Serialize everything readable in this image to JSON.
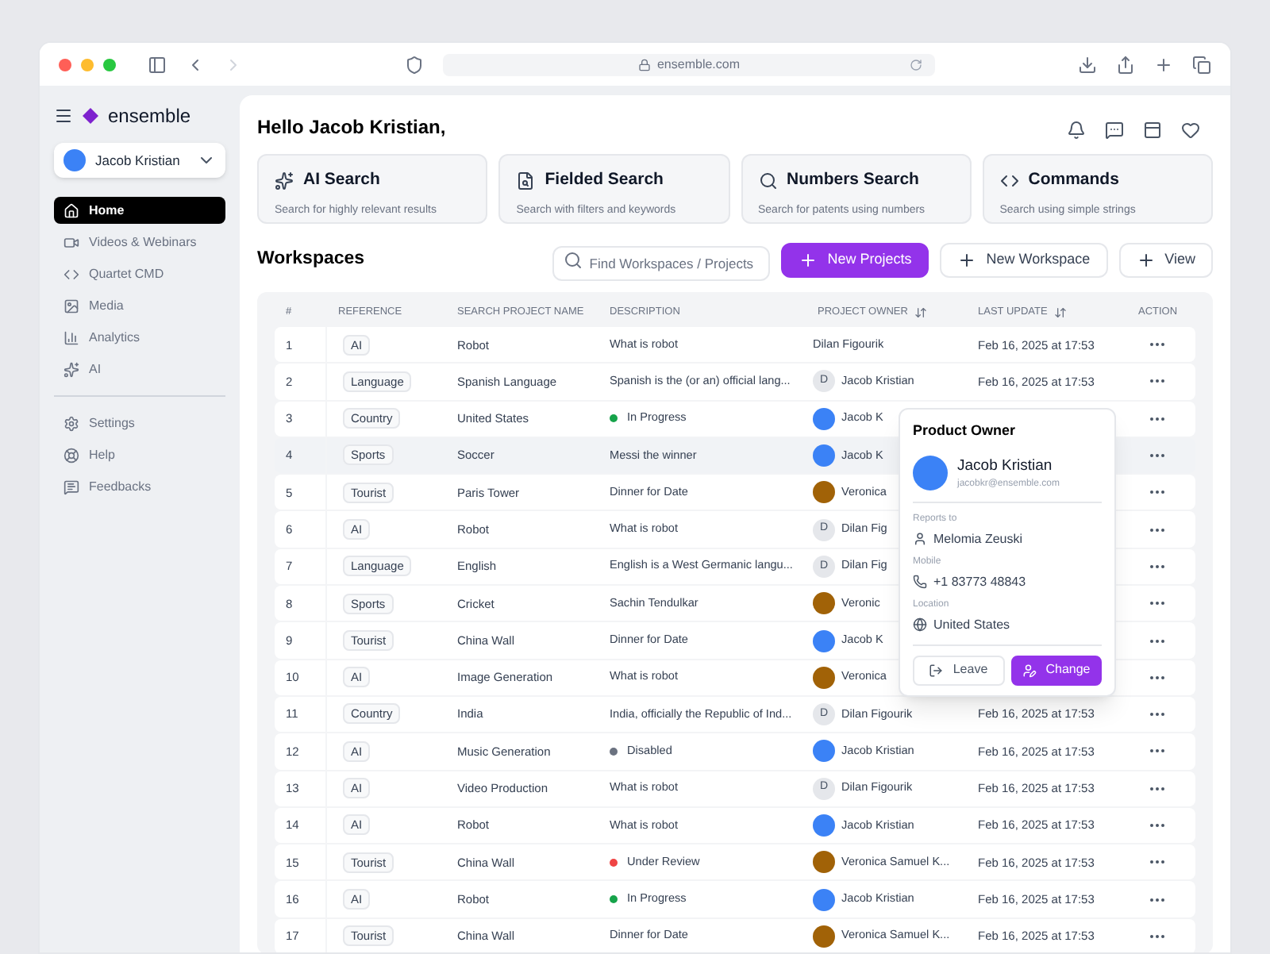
{
  "browser": {
    "url": "ensemble.com"
  },
  "sidebar": {
    "brand": "ensemble",
    "user": "Jacob Kristian",
    "items": [
      {
        "label": "Home",
        "selected": true
      },
      {
        "label": "Videos & Webinars",
        "selected": false
      },
      {
        "label": "Quartet CMD",
        "selected": false
      },
      {
        "label": "Media",
        "selected": false
      },
      {
        "label": "Analytics",
        "selected": false
      },
      {
        "label": "AI",
        "selected": false
      }
    ],
    "footer_items": [
      {
        "label": "Settings"
      },
      {
        "label": "Help"
      },
      {
        "label": "Feedbacks"
      }
    ]
  },
  "greeting": "Hello Jacob Kristian,",
  "search_cards": [
    {
      "title": "AI Search",
      "subtitle": "Search for highly relevant results"
    },
    {
      "title": "Fielded Search",
      "subtitle": "Search with filters and keywords"
    },
    {
      "title": "Numbers Search",
      "subtitle": "Search for patents using numbers"
    },
    {
      "title": "Commands",
      "subtitle": "Search using simple strings"
    }
  ],
  "workspaces": {
    "title": "Workspaces",
    "search": {
      "placeholder": "Find Workspaces / Projects"
    },
    "buttons": [
      {
        "label": "New Projects",
        "kind": "primary"
      },
      {
        "label": "New Workspace",
        "kind": "outline"
      },
      {
        "label": "View",
        "kind": "outline"
      }
    ]
  },
  "table": {
    "columns": [
      {
        "label": "#",
        "sortable": false
      },
      {
        "label": "REFERENCE",
        "sortable": false
      },
      {
        "label": "SEARCH PROJECT NAME",
        "sortable": false
      },
      {
        "label": "DESCRIPTION",
        "sortable": false
      },
      {
        "label": "PROJECT OWNER",
        "sortable": true
      },
      {
        "label": "LAST UPDATE",
        "sortable": true
      },
      {
        "label": "ACTION",
        "sortable": false
      }
    ],
    "rows": [
      {
        "num": "1",
        "reference": "AI",
        "name": "Robot",
        "description": {
          "kind": "text",
          "text": "What is robot"
        },
        "owner": {
          "kind": "none",
          "name": "Dilan Figourik"
        },
        "updated": "Feb 16, 2025 at 17:53",
        "selected": false
      },
      {
        "num": "2",
        "reference": "Language",
        "name": "Spanish Language",
        "description": {
          "kind": "text",
          "text": "Spanish is the (or an) official lang..."
        },
        "owner": {
          "kind": "initial",
          "initial": "D",
          "name": "Jacob Kristian"
        },
        "updated": "Feb 16, 2025 at 17:53",
        "selected": false
      },
      {
        "num": "3",
        "reference": "Country",
        "name": "United States",
        "description": {
          "kind": "status",
          "text": "In Progress",
          "color": "#16a34a"
        },
        "owner": {
          "kind": "photo",
          "color": "#3b82f6",
          "name": "Jacob K"
        },
        "selected": false
      },
      {
        "num": "4",
        "reference": "Sports",
        "name": "Soccer",
        "description": {
          "kind": "text",
          "text": "Messi the winner"
        },
        "owner": {
          "kind": "photo",
          "color": "#3b82f6",
          "name": "Jacob K"
        },
        "selected": true
      },
      {
        "num": "5",
        "reference": "Tourist",
        "name": "Paris Tower",
        "description": {
          "kind": "text",
          "text": "Dinner for Date"
        },
        "owner": {
          "kind": "photo",
          "color": "#a16207",
          "name": "Veronica"
        },
        "selected": false
      },
      {
        "num": "6",
        "reference": "AI",
        "name": "Robot",
        "description": {
          "kind": "text",
          "text": "What is robot"
        },
        "owner": {
          "kind": "initial",
          "initial": "D",
          "name": "Dilan Fig"
        },
        "selected": false
      },
      {
        "num": "7",
        "reference": "Language",
        "name": "English",
        "description": {
          "kind": "text",
          "text": "English is a West Germanic langu..."
        },
        "owner": {
          "kind": "initial",
          "initial": "D",
          "name": "Dilan Fig"
        },
        "selected": false
      },
      {
        "num": "8",
        "reference": "Sports",
        "name": "Cricket",
        "description": {
          "kind": "text",
          "text": "Sachin Tendulkar"
        },
        "owner": {
          "kind": "photo",
          "color": "#a16207",
          "name": "Veronic"
        },
        "selected": false
      },
      {
        "num": "9",
        "reference": "Tourist",
        "name": "China Wall",
        "description": {
          "kind": "text",
          "text": "Dinner for Date"
        },
        "owner": {
          "kind": "photo",
          "color": "#3b82f6",
          "name": "Jacob K"
        },
        "selected": false
      },
      {
        "num": "10",
        "reference": "AI",
        "name": "Image Generation",
        "description": {
          "kind": "text",
          "text": "What is robot"
        },
        "owner": {
          "kind": "photo",
          "color": "#a16207",
          "name": "Veronica"
        },
        "selected": false
      },
      {
        "num": "11",
        "reference": "Country",
        "name": "India",
        "description": {
          "kind": "text",
          "text": "India, officially the Republic of Ind..."
        },
        "owner": {
          "kind": "initial",
          "initial": "D",
          "name": "Dilan Figourik"
        },
        "updated": "Feb 16, 2025 at 17:53",
        "selected": false
      },
      {
        "num": "12",
        "reference": "AI",
        "name": "Music Generation",
        "description": {
          "kind": "status",
          "text": "Disabled",
          "color": "#6b7280"
        },
        "owner": {
          "kind": "photo",
          "color": "#3b82f6",
          "name": "Jacob Kristian"
        },
        "updated": "Feb 16, 2025 at 17:53",
        "selected": false
      },
      {
        "num": "13",
        "reference": "AI",
        "name": "Video Production",
        "description": {
          "kind": "text",
          "text": "What is robot"
        },
        "owner": {
          "kind": "initial",
          "initial": "D",
          "name": "Dilan Figourik"
        },
        "updated": "Feb 16, 2025 at 17:53",
        "selected": false
      },
      {
        "num": "14",
        "reference": "AI",
        "name": "Robot",
        "description": {
          "kind": "text",
          "text": "What is robot"
        },
        "owner": {
          "kind": "photo",
          "color": "#3b82f6",
          "name": "Jacob Kristian"
        },
        "updated": "Feb 16, 2025 at 17:53",
        "selected": false
      },
      {
        "num": "15",
        "reference": "Tourist",
        "name": "China Wall",
        "description": {
          "kind": "status",
          "text": "Under Review",
          "color": "#ef4444"
        },
        "owner": {
          "kind": "photo",
          "color": "#a16207",
          "name": "Veronica Samuel K..."
        },
        "updated": "Feb 16, 2025 at 17:53",
        "selected": false
      },
      {
        "num": "16",
        "reference": "AI",
        "name": "Robot",
        "description": {
          "kind": "status",
          "text": "In Progress",
          "color": "#16a34a"
        },
        "owner": {
          "kind": "photo",
          "color": "#3b82f6",
          "name": "Jacob Kristian"
        },
        "updated": "Feb 16, 2025 at 17:53",
        "selected": false
      },
      {
        "num": "17",
        "reference": "Tourist",
        "name": "China Wall",
        "description": {
          "kind": "text",
          "text": "Dinner for Date"
        },
        "owner": {
          "kind": "photo",
          "color": "#a16207",
          "name": "Veronica Samuel K..."
        },
        "updated": "Feb 16, 2025 at 17:53",
        "selected": false
      }
    ]
  },
  "popover": {
    "title": "Product Owner",
    "name": "Jacob Kristian",
    "email": "jacobkr@ensemble.com",
    "fields": [
      {
        "label": "Reports to",
        "value": "Melomia Zeuski"
      },
      {
        "label": "Mobile",
        "value": "+1 83773 48843"
      },
      {
        "label": "Location",
        "value": "United States"
      }
    ],
    "buttons": [
      {
        "label": "Leave",
        "kind": "outline"
      },
      {
        "label": "Change",
        "kind": "primary"
      }
    ]
  }
}
